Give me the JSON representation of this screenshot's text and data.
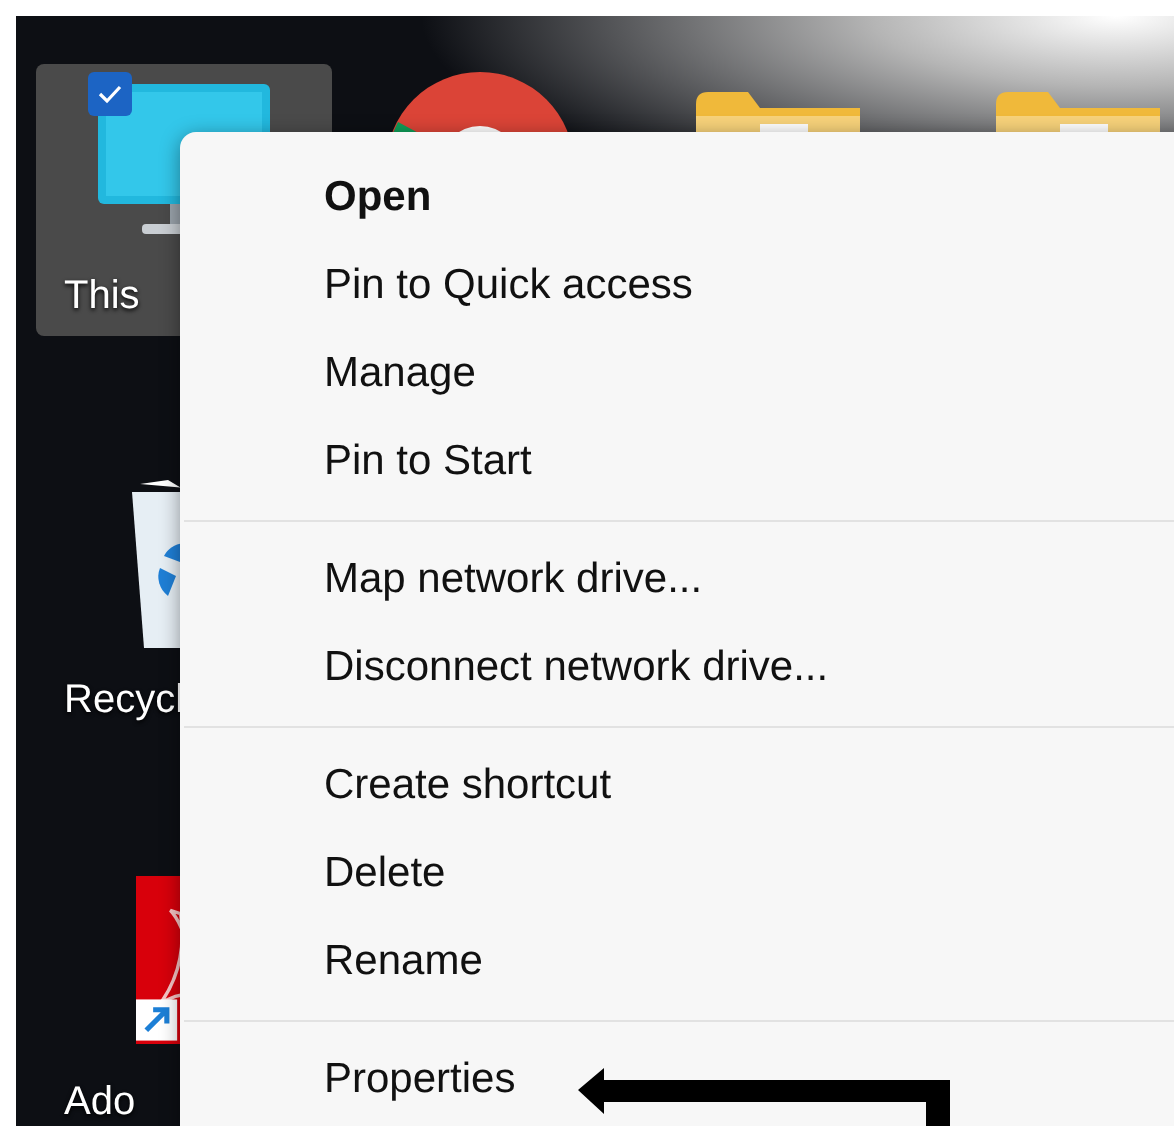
{
  "desktop": {
    "icons": [
      {
        "kind": "computer",
        "label": "This",
        "selected": true,
        "checked": true
      },
      {
        "kind": "recycle",
        "label": "Recycl",
        "selected": false,
        "checked": false
      },
      {
        "kind": "pdf",
        "label": "Ado",
        "selected": false,
        "checked": false
      },
      {
        "kind": "browser"
      },
      {
        "kind": "folder"
      },
      {
        "kind": "folder"
      }
    ]
  },
  "context_menu": {
    "groups": [
      [
        {
          "label": "Open",
          "default": true
        },
        {
          "label": "Pin to Quick access",
          "default": false
        },
        {
          "label": "Manage",
          "default": false
        },
        {
          "label": "Pin to Start",
          "default": false
        }
      ],
      [
        {
          "label": "Map network drive...",
          "default": false
        },
        {
          "label": "Disconnect network drive...",
          "default": false
        }
      ],
      [
        {
          "label": "Create shortcut",
          "default": false
        },
        {
          "label": "Delete",
          "default": false
        },
        {
          "label": "Rename",
          "default": false
        }
      ],
      [
        {
          "label": "Properties",
          "default": false
        }
      ]
    ]
  }
}
